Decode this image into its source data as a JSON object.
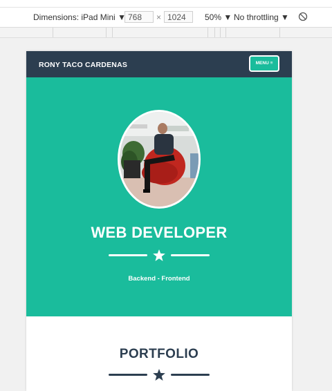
{
  "devtools": {
    "dimensions_label": "Dimensions: iPad Mini",
    "width": "768",
    "times": "×",
    "height": "1024",
    "zoom": "50%",
    "throttling": "No throttling",
    "rotate_icon": "rotate-icon"
  },
  "site": {
    "brand": "RONY TACO CARDENAS",
    "menu_label": "MENU ≡",
    "hero_title": "WEB DEVELOPER",
    "hero_subtitle": "Backend - Frontend",
    "section_title": "PORTFOLIO"
  },
  "colors": {
    "primary": "#2c3e50",
    "accent": "#1abc9c",
    "white": "#ffffff"
  }
}
